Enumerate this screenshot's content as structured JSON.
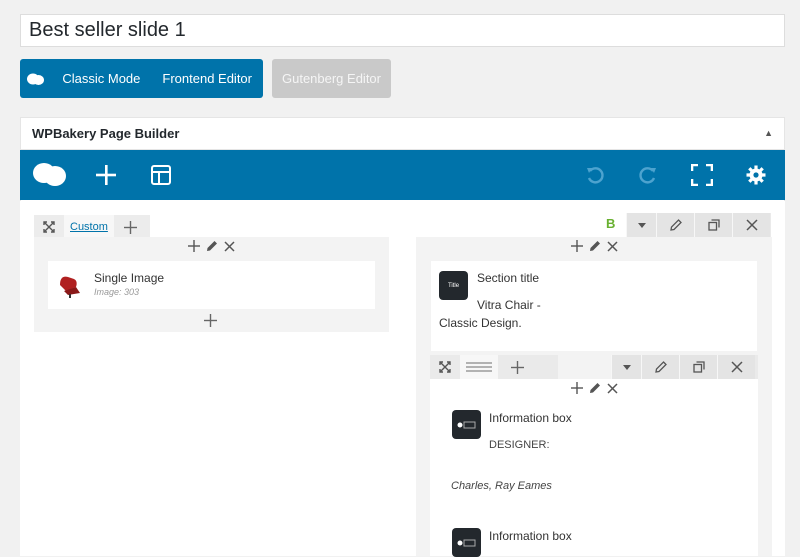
{
  "post": {
    "title": "Best seller slide 1"
  },
  "editor_modes": {
    "classic_label": "Classic Mode",
    "frontend_label": "Frontend Editor",
    "gutenberg_label": "Gutenberg Editor"
  },
  "builder": {
    "title": "WPBakery Page Builder",
    "accent": "#0073aa"
  },
  "left_row": {
    "tab_label": "Custom",
    "element": {
      "title": "Single Image",
      "subtitle": "Image: 303"
    }
  },
  "right_column": {
    "section_title": {
      "title": "Section title",
      "icon_text": "Title",
      "text_line1": "Vitra Chair -",
      "text_line2": "Classic Design."
    },
    "info_box_1": {
      "title": "Information box",
      "label": "DESIGNER:",
      "value": "Charles, Ray Eames"
    },
    "info_box_2": {
      "title": "Information box"
    }
  }
}
